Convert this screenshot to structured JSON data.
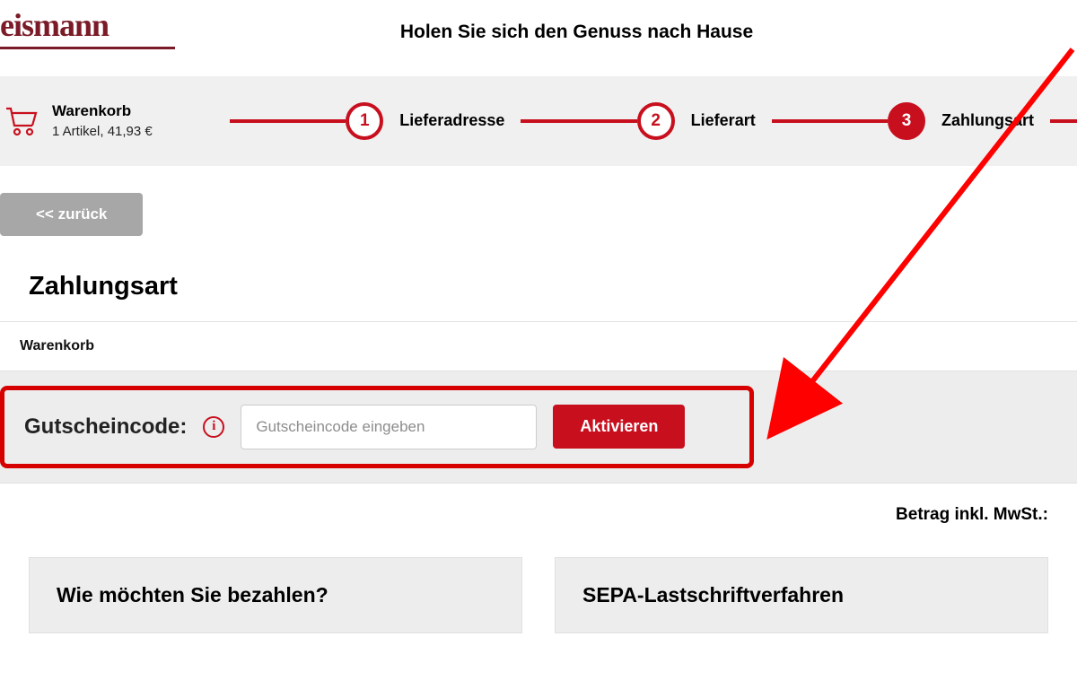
{
  "logo": "eismann",
  "tagline": "Holen Sie sich den Genuss nach Hause",
  "cart": {
    "title": "Warenkorb",
    "summary": "1 Artikel, 41,93 €"
  },
  "steps": [
    {
      "num": "1",
      "label": "Lieferadresse",
      "active": false
    },
    {
      "num": "2",
      "label": "Lieferart",
      "active": false
    },
    {
      "num": "3",
      "label": "Zahlungsart",
      "active": true
    }
  ],
  "back_button": "<< zurück",
  "page_title": "Zahlungsart",
  "cart_section_label": "Warenkorb",
  "coupon": {
    "label": "Gutscheincode:",
    "info_glyph": "i",
    "placeholder": "Gutscheincode eingeben",
    "button": "Aktivieren"
  },
  "total_label": "Betrag inkl. MwSt.:",
  "payment_card_title": "Wie möchten Sie bezahlen?",
  "sepa_card_title": "SEPA-Lastschriftverfahren"
}
